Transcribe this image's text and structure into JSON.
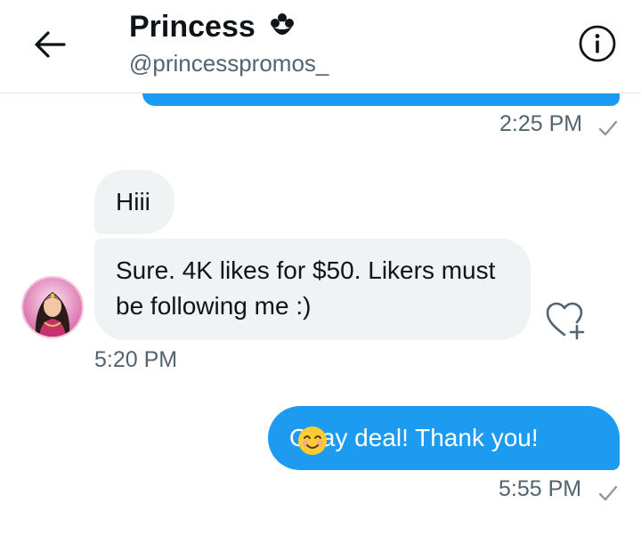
{
  "header": {
    "name": "Princess",
    "handle": "@princesspromos_"
  },
  "messages": {
    "sent_top_time": "2:25 PM",
    "received": [
      "Hiii",
      "Sure. 4K likes for $50. Likers must be following me :)"
    ],
    "received_time": "5:20 PM",
    "sent_text": "Okay deal! Thank you!",
    "sent_time": "5:55 PM"
  },
  "icons": {
    "back": "arrow-left-icon",
    "info": "info-icon",
    "flower": "flower-icon",
    "react": "heart-plus-icon",
    "check": "check-icon",
    "emoji": "smiling-face-emoji"
  },
  "colors": {
    "accent": "#1d9bf0",
    "incoming_bubble": "#eff3f4",
    "muted_text": "#536471"
  }
}
